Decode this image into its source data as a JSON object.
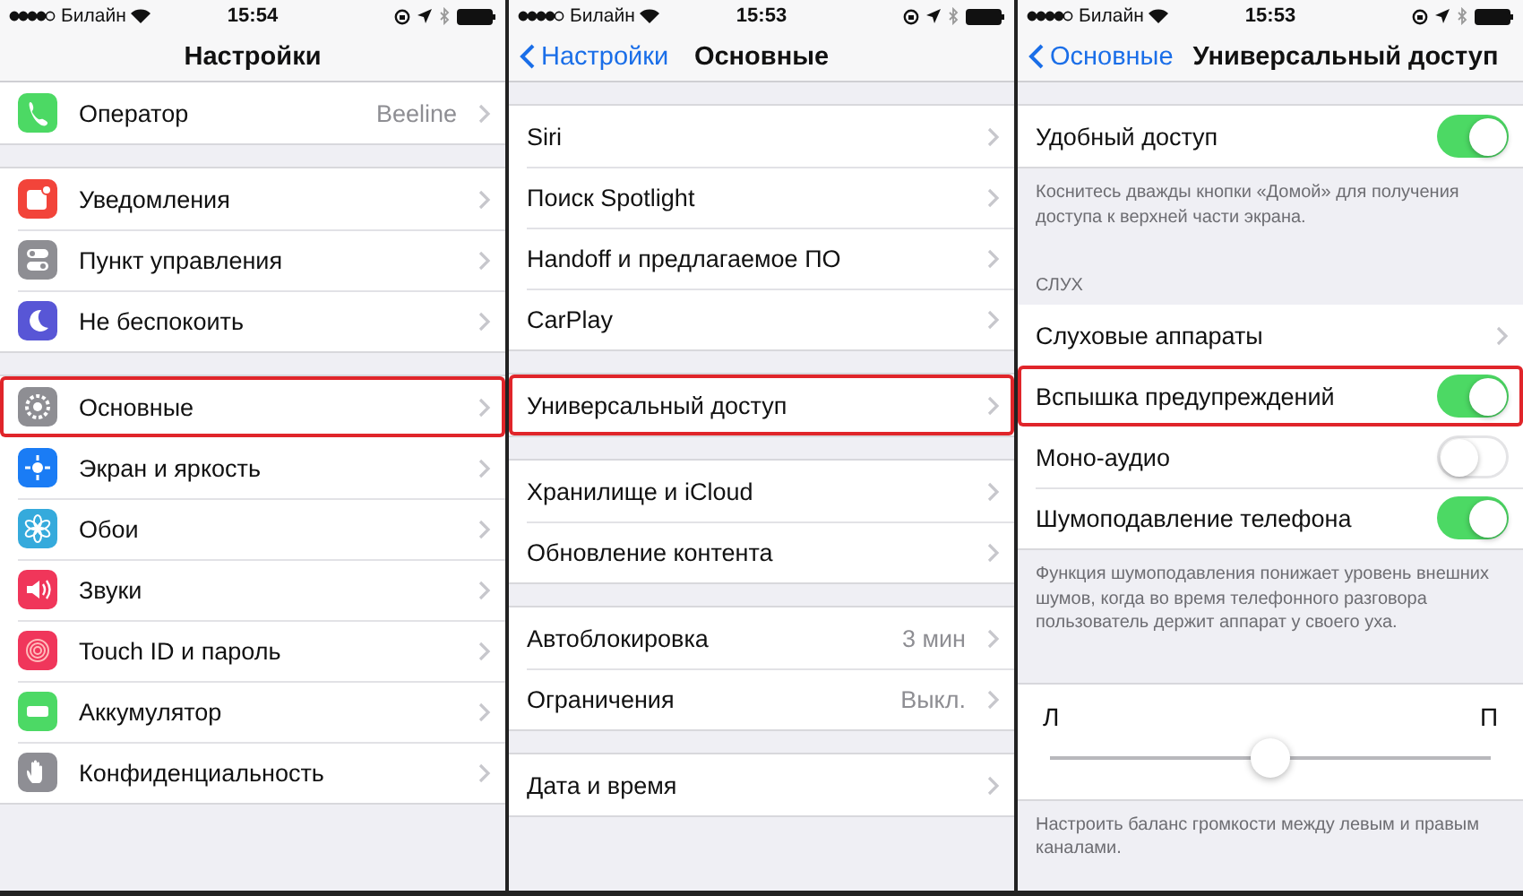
{
  "screens": [
    {
      "status_bar": {
        "carrier": "Билайн",
        "time": "15:54"
      },
      "nav": {
        "title": "Настройки"
      },
      "sections": [
        {
          "kind": "group",
          "gap": false,
          "rows": [
            {
              "kind": "link",
              "label": "Оператор",
              "value": "Beeline",
              "color": "#4cd964",
              "highlighted": false
            }
          ]
        },
        {
          "kind": "group",
          "gap": true,
          "rows": [
            {
              "kind": "link",
              "label": "Уведомления",
              "color": "#f2443a",
              "highlighted": false
            },
            {
              "kind": "link",
              "label": "Пункт управления",
              "color": "#8e8e93",
              "highlighted": false
            },
            {
              "kind": "link",
              "label": "Не беспокоить",
              "color": "#5856d6",
              "highlighted": false
            }
          ]
        },
        {
          "kind": "group",
          "gap": true,
          "rows": [
            {
              "kind": "link",
              "label": "Основные",
              "color": "#8e8e93",
              "highlighted": true
            },
            {
              "kind": "link",
              "label": "Экран и яркость",
              "color": "#1a7cf5",
              "highlighted": false
            },
            {
              "kind": "link",
              "label": "Обои",
              "color": "#35aadc",
              "highlighted": false
            },
            {
              "kind": "link",
              "label": "Звуки",
              "color": "#f0365a",
              "highlighted": false
            },
            {
              "kind": "link",
              "label": "Touch ID и пароль",
              "color": "#f0365b",
              "highlighted": false
            },
            {
              "kind": "link",
              "label": "Аккумулятор",
              "color": "#4cd965",
              "highlighted": false
            },
            {
              "kind": "link",
              "label": "Конфиденциальность",
              "color": "#8e8e94",
              "highlighted": false
            }
          ]
        }
      ]
    },
    {
      "status_bar": {
        "carrier": "Билайн",
        "time": "15:53"
      },
      "nav": {
        "back": "Настройки",
        "title": "Основные"
      },
      "sections": [
        {
          "kind": "group",
          "gap": true,
          "rows": [
            {
              "kind": "link",
              "label": "Siri",
              "highlighted": false
            },
            {
              "kind": "link",
              "label": "Поиск Spotlight",
              "highlighted": false
            },
            {
              "kind": "link",
              "label": "Handoff и предлагаемое ПО",
              "highlighted": false
            },
            {
              "kind": "link",
              "label": "CarPlay",
              "highlighted": false
            }
          ]
        },
        {
          "kind": "group",
          "gap": true,
          "rows": [
            {
              "kind": "link",
              "label": "Универсальный доступ",
              "highlighted": true
            }
          ]
        },
        {
          "kind": "group",
          "gap": true,
          "rows": [
            {
              "kind": "link",
              "label": "Хранилище и iCloud",
              "highlighted": false
            },
            {
              "kind": "link",
              "label": "Обновление контента",
              "highlighted": false
            }
          ]
        },
        {
          "kind": "group",
          "gap": true,
          "rows": [
            {
              "kind": "link",
              "label": "Автоблокировка",
              "value": "3 мин",
              "highlighted": false
            },
            {
              "kind": "link",
              "label": "Ограничения",
              "value": "Выкл.",
              "highlighted": false
            }
          ]
        },
        {
          "kind": "group",
          "gap": true,
          "rows": [
            {
              "kind": "link",
              "label": "Дата и время",
              "highlighted": false
            }
          ]
        }
      ]
    },
    {
      "status_bar": {
        "carrier": "Билайн",
        "time": "15:53"
      },
      "nav": {
        "back": "Основные",
        "title": "Универсальный доступ"
      },
      "sections": [
        {
          "kind": "group",
          "gap": true,
          "rows": [
            {
              "kind": "switch",
              "label": "Удобный доступ",
              "on": true,
              "highlighted": false
            }
          ]
        },
        {
          "kind": "footer",
          "text": "Коснитесь дважды кнопки «Домой» для получения доступа к верхней части экрана."
        },
        {
          "kind": "header",
          "text": "СЛУХ"
        },
        {
          "kind": "group",
          "gap": false,
          "rows": [
            {
              "kind": "link",
              "label": "Слуховые аппараты",
              "highlighted": false
            },
            {
              "kind": "switch",
              "label": "Вспышка предупреждений",
              "on": true,
              "highlighted": true
            },
            {
              "kind": "switch",
              "label": "Моно-аудио",
              "on": false,
              "highlighted": false
            },
            {
              "kind": "switch",
              "label": "Шумоподавление телефона",
              "on": true,
              "highlighted": false
            }
          ]
        },
        {
          "kind": "footer",
          "text": "Функция шумоподавления понижает уровень внешних шумов, когда во время телефонного разговора пользователь держит аппарат у своего уха."
        },
        {
          "kind": "slider",
          "left": "Л",
          "right": "П",
          "level": 0.5
        },
        {
          "kind": "footer",
          "text": "Настроить баланс громкости между левым и правым каналами."
        }
      ]
    }
  ]
}
